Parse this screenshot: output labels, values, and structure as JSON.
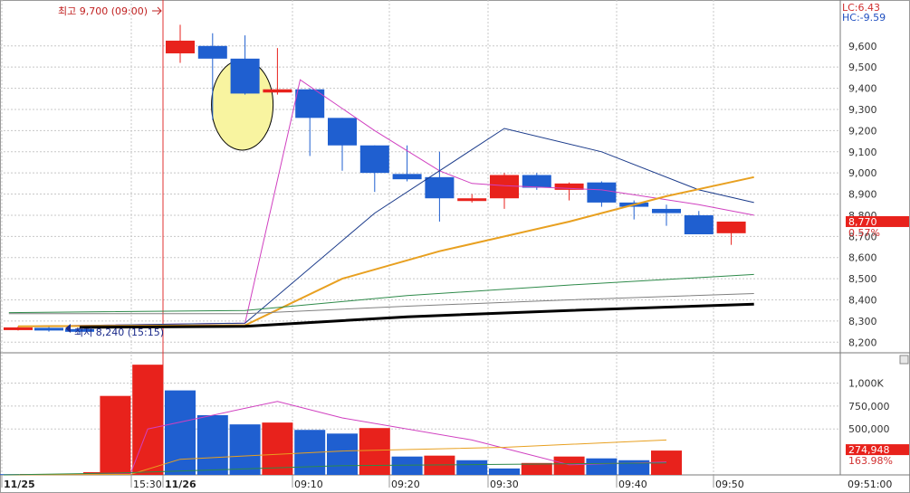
{
  "chart_data": {
    "type": "candlestick",
    "price_panel": {
      "ylim": [
        8150,
        9800
      ],
      "yticks": [
        9600,
        9500,
        9400,
        9300,
        9200,
        9100,
        9000,
        8900,
        8800,
        8700,
        8600,
        8500,
        8400,
        8300,
        8200
      ],
      "ytick_labels": [
        "9,600",
        "9,500",
        "9,400",
        "9,300",
        "9,200",
        "9,100",
        "9,000",
        "8,900",
        "8,800",
        "8,700",
        "8,600",
        "8,500",
        "8,400",
        "8,300",
        "8,200"
      ],
      "lc_label": "LC:6.43",
      "hc_label": "HC:-9.59",
      "high_annotation": "최고 9,700 (09:00)",
      "low_annotation": "최저 8,240 (15:15)",
      "current_price": "8,770",
      "current_change": "0.57%",
      "candles": [
        {
          "time": "11/25 15:0x",
          "o": 8270,
          "h": 8275,
          "l": 8255,
          "c": 8265,
          "color": "red"
        },
        {
          "time": "11/25 15:1x",
          "o": 8268,
          "h": 8272,
          "l": 8250,
          "c": 8256,
          "color": "blue"
        },
        {
          "time": "11/25 15:15",
          "o": 8262,
          "h": 8270,
          "l": 8240,
          "c": 8252,
          "color": "blue"
        },
        {
          "time": "09:00",
          "o": 9565,
          "h": 9700,
          "l": 9520,
          "c": 9625,
          "color": "red"
        },
        {
          "time": "09:02",
          "o": 9600,
          "h": 9660,
          "l": 9250,
          "c": 9540,
          "color": "blue"
        },
        {
          "time": "09:04",
          "o": 9540,
          "h": 9650,
          "l": 9370,
          "c": 9375,
          "color": "blue"
        },
        {
          "time": "09:06",
          "o": 9380,
          "h": 9590,
          "l": 9370,
          "c": 9395,
          "color": "red"
        },
        {
          "time": "09:10",
          "o": 9395,
          "h": 9400,
          "l": 9080,
          "c": 9260,
          "color": "blue"
        },
        {
          "time": "09:12",
          "o": 9260,
          "h": 9260,
          "l": 9010,
          "c": 9130,
          "color": "blue"
        },
        {
          "time": "09:15",
          "o": 9130,
          "h": 9130,
          "l": 8910,
          "c": 9000,
          "color": "blue"
        },
        {
          "time": "09:18",
          "o": 8995,
          "h": 9130,
          "l": 8960,
          "c": 8970,
          "color": "blue"
        },
        {
          "time": "09:22",
          "o": 8980,
          "h": 9100,
          "l": 8770,
          "c": 8880,
          "color": "blue"
        },
        {
          "time": "09:25",
          "o": 8875,
          "h": 8900,
          "l": 8860,
          "c": 8880,
          "color": "red"
        },
        {
          "time": "09:30",
          "o": 8880,
          "h": 9000,
          "l": 8830,
          "c": 8990,
          "color": "red"
        },
        {
          "time": "09:33",
          "o": 8990,
          "h": 9000,
          "l": 8920,
          "c": 8930,
          "color": "blue"
        },
        {
          "time": "09:36",
          "o": 8920,
          "h": 8955,
          "l": 8870,
          "c": 8950,
          "color": "red"
        },
        {
          "time": "09:39",
          "o": 8955,
          "h": 8960,
          "l": 8840,
          "c": 8860,
          "color": "blue"
        },
        {
          "time": "09:42",
          "o": 8860,
          "h": 8870,
          "l": 8780,
          "c": 8840,
          "color": "blue"
        },
        {
          "time": "09:45",
          "o": 8830,
          "h": 8850,
          "l": 8750,
          "c": 8810,
          "color": "blue"
        },
        {
          "time": "09:48",
          "o": 8800,
          "h": 8820,
          "l": 8710,
          "c": 8710,
          "color": "blue"
        },
        {
          "time": "09:50",
          "o": 8715,
          "h": 8770,
          "l": 8660,
          "c": 8770,
          "color": "red"
        }
      ],
      "ma_lines": [
        {
          "color": "#d040c0",
          "width": 1,
          "points": [
            [
              0,
              8275
            ],
            [
              5,
              8290
            ],
            [
              6.7,
              9440
            ],
            [
              9,
              9200
            ],
            [
              11,
              9010
            ],
            [
              12,
              8950
            ],
            [
              13,
              8940
            ],
            [
              16,
              8920
            ],
            [
              19,
              8850
            ],
            [
              20.7,
              8800
            ]
          ]
        },
        {
          "color": "#1a3a8a",
          "width": 1,
          "points": [
            [
              0,
              8275
            ],
            [
              5,
              8290
            ],
            [
              9,
              8810
            ],
            [
              13,
              9210
            ],
            [
              16,
              9100
            ],
            [
              19,
              8920
            ],
            [
              20.7,
              8860
            ]
          ]
        },
        {
          "color": "#e8a020",
          "width": 2,
          "points": [
            [
              0,
              8275
            ],
            [
              5,
              8280
            ],
            [
              8,
              8500
            ],
            [
              11,
              8630
            ],
            [
              15,
              8770
            ],
            [
              18,
              8890
            ],
            [
              20.7,
              8980
            ]
          ]
        },
        {
          "color": "#2e8a4a",
          "width": 1,
          "points": [
            [
              -0.3,
              8340
            ],
            [
              5,
              8350
            ],
            [
              10,
              8420
            ],
            [
              15,
              8470
            ],
            [
              20.7,
              8520
            ]
          ]
        },
        {
          "color": "#808080",
          "width": 1,
          "points": [
            [
              -0.3,
              8335
            ],
            [
              5,
              8335
            ],
            [
              10,
              8370
            ],
            [
              15,
              8400
            ],
            [
              20.7,
              8430
            ]
          ]
        },
        {
          "color": "#000000",
          "width": 3,
          "points": [
            [
              2,
              8270
            ],
            [
              5,
              8275
            ],
            [
              10,
              8320
            ],
            [
              15,
              8350
            ],
            [
              20.7,
              8380
            ]
          ]
        }
      ]
    },
    "volume_panel": {
      "ylim": [
        0,
        1300000
      ],
      "yticks": [
        1000000,
        750000,
        500000
      ],
      "ytick_labels": [
        "1,000K",
        "750,000",
        "500,000"
      ],
      "current_volume": "274,948",
      "current_ratio": "163.98%",
      "bars": [
        {
          "v": 8000,
          "color": "blue"
        },
        {
          "v": 10000,
          "color": "red"
        },
        {
          "v": 8000,
          "color": "blue"
        },
        {
          "v": 30000,
          "color": "red"
        },
        {
          "v": 14000,
          "color": "blue"
        },
        {
          "v": 860000,
          "color": "red"
        },
        {
          "v": 1200000,
          "color": "red"
        },
        {
          "v": 920000,
          "color": "blue"
        },
        {
          "v": 650000,
          "color": "blue"
        },
        {
          "v": 550000,
          "color": "blue"
        },
        {
          "v": 570000,
          "color": "red"
        },
        {
          "v": 490000,
          "color": "blue"
        },
        {
          "v": 450000,
          "color": "blue"
        },
        {
          "v": 510000,
          "color": "red"
        },
        {
          "v": 200000,
          "color": "blue"
        },
        {
          "v": 210000,
          "color": "red"
        },
        {
          "v": 160000,
          "color": "blue"
        },
        {
          "v": 70000,
          "color": "blue"
        },
        {
          "v": 130000,
          "color": "red"
        },
        {
          "v": 200000,
          "color": "red"
        },
        {
          "v": 180000,
          "color": "blue"
        },
        {
          "v": 160000,
          "color": "blue"
        },
        {
          "v": 265000,
          "color": "red"
        }
      ],
      "ma_lines": [
        {
          "color": "#d040c0",
          "points": [
            [
              0,
              0
            ],
            [
              4,
              10000
            ],
            [
              6,
              500000
            ],
            [
              10,
              800000
            ],
            [
              12,
              620000
            ],
            [
              16,
              380000
            ],
            [
              19,
              110000
            ],
            [
              22,
              140000
            ]
          ]
        },
        {
          "color": "#e8a020",
          "points": [
            [
              0,
              0
            ],
            [
              4,
              5000
            ],
            [
              7,
              170000
            ],
            [
              12,
              260000
            ],
            [
              17,
              300000
            ],
            [
              22,
              380000
            ]
          ]
        },
        {
          "color": "#2e8a4a",
          "points": [
            [
              0,
              0
            ],
            [
              5,
              20000
            ],
            [
              12,
              100000
            ],
            [
              22,
              130000
            ]
          ]
        }
      ]
    },
    "x_axis": {
      "labels": [
        "11/25",
        "15:30",
        "11/26",
        "09:10",
        "09:20",
        "09:30",
        "09:40",
        "09:50"
      ],
      "bold_labels": [
        "11/25",
        "11/26"
      ],
      "clock": "09:51:00"
    }
  },
  "colors": {
    "up": "#e8221c",
    "down": "#1f5fd0",
    "grid": "#c8c8c8",
    "axis_bg": "#ffffff",
    "highlight": "#f8f4a0"
  }
}
